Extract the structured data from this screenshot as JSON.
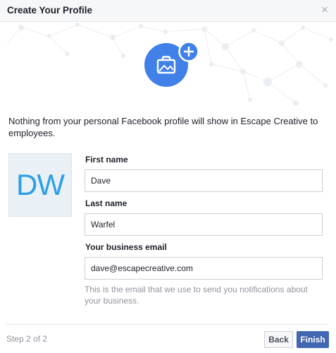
{
  "dialog": {
    "title": "Create Your Profile",
    "close_glyph": "×"
  },
  "hero": {
    "icon": "briefcase-icon",
    "badge_icon": "plus-icon",
    "accent_color": "#4080e8"
  },
  "intro_text": "Nothing from your personal Facebook profile will show in Escape Creative to employees.",
  "avatar": {
    "initials": "DW",
    "color": "#2d9ee6"
  },
  "form": {
    "first_name": {
      "label": "First name",
      "value": "Dave"
    },
    "last_name": {
      "label": "Last name",
      "value": "Warfel"
    },
    "email": {
      "label": "Your business email",
      "value": "dave@escapecreative.com"
    },
    "help_text": "This is the email that we use to send you notifications about your business."
  },
  "footer": {
    "step": "Step 2 of 2",
    "back_label": "Back",
    "finish_label": "Finish",
    "finish_color": "#4267b2"
  }
}
